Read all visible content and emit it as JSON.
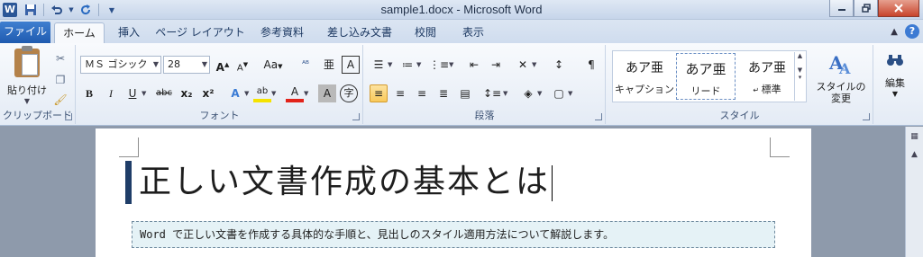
{
  "app": {
    "title": "sample1.docx - Microsoft Word",
    "logo_letter": "W"
  },
  "qat": {
    "save_icon": "save-icon",
    "undo_icon": "undo-icon",
    "redo_icon": "redo-icon"
  },
  "tabs": [
    {
      "label": "ファイル"
    },
    {
      "label": "ホーム"
    },
    {
      "label": "挿入"
    },
    {
      "label": "ページ レイアウト"
    },
    {
      "label": "参考資料"
    },
    {
      "label": "差し込み文書"
    },
    {
      "label": "校閲"
    },
    {
      "label": "表示"
    }
  ],
  "ribbon": {
    "clipboard": {
      "paste_label": "貼り付け",
      "group_label": "クリップボード"
    },
    "font": {
      "font_name": "ＭＳ ゴシック",
      "font_size": "28",
      "group_label": "フォント",
      "bold": "B",
      "italic": "I",
      "underline": "U",
      "strike": "abc",
      "sub": "x₂",
      "sup": "x²",
      "case": "Aa",
      "grow": "A",
      "shrink": "A"
    },
    "paragraph": {
      "group_label": "段落"
    },
    "styles": {
      "group_label": "スタイル",
      "sample": "あア亜",
      "items": [
        {
          "name": "キャプション"
        },
        {
          "name": "リード"
        },
        {
          "name": "標準"
        }
      ],
      "change_label": "スタイルの\n変更"
    },
    "editing": {
      "label": "編集"
    }
  },
  "document": {
    "heading": "正しい文書作成の基本とは",
    "lead": "Word で正しい文書を作成する具体的な手順と、見出しのスタイル適用方法について解説します。"
  },
  "colors": {
    "accent": "#2b5797",
    "file_tab": "#2a6bc1",
    "heading_bar": "#1f3d68",
    "lead_bg": "#e5f2f6"
  }
}
